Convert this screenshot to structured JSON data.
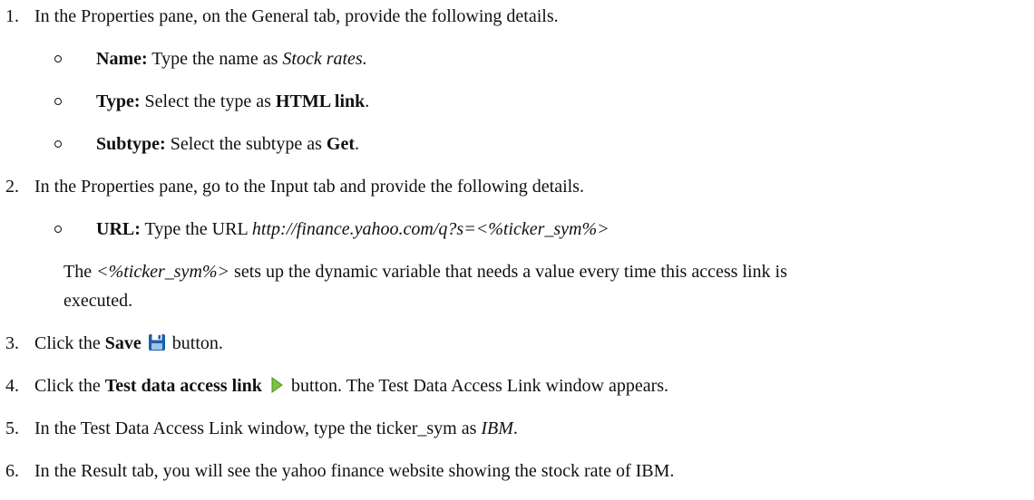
{
  "steps": [
    {
      "number": "1.",
      "text": "In the Properties pane, on the General tab, provide the following details.",
      "bullets": [
        {
          "label": "Name:",
          "text": "Type the name as",
          "value": "Stock rates."
        },
        {
          "label": "Type:",
          "text": "Select the type as",
          "value": "HTML link",
          "end": "."
        },
        {
          "label": "Subtype:",
          "text": "Select the subtype as",
          "value": "Get",
          "end": "."
        }
      ]
    },
    {
      "number": "2.",
      "text": "In the Properties pane, go to the Input tab and provide the following details.",
      "bullets": [
        {
          "label": "URL:",
          "text": "Type the URL",
          "value": "http://finance.yahoo.com/q?s=<%ticker_sym%>"
        }
      ],
      "note": {
        "prefix": "The",
        "variable": "<%ticker_sym%>",
        "line1": "sets up the dynamic variable that needs a value every time this access link is",
        "line2": "executed."
      }
    },
    {
      "number": "3.",
      "pre": "Click the",
      "bold": "Save",
      "icon": "save-floppy-icon",
      "post": "button."
    },
    {
      "number": "4.",
      "pre": "Click the",
      "bold": "Test data access link",
      "icon": "play-triangle-icon",
      "post": "button. The Test Data Access Link window appears."
    },
    {
      "number": "5.",
      "pre": "In the Test Data Access Link window, type the ticker_sym as",
      "italic": "IBM",
      "post": "."
    },
    {
      "number": "6.",
      "text": "In the Result tab, you will see the yahoo finance website showing the stock rate of IBM."
    }
  ],
  "colors": {
    "text": "#111111",
    "save_icon": "#1f5fa8",
    "play_icon": "#7cc242"
  }
}
